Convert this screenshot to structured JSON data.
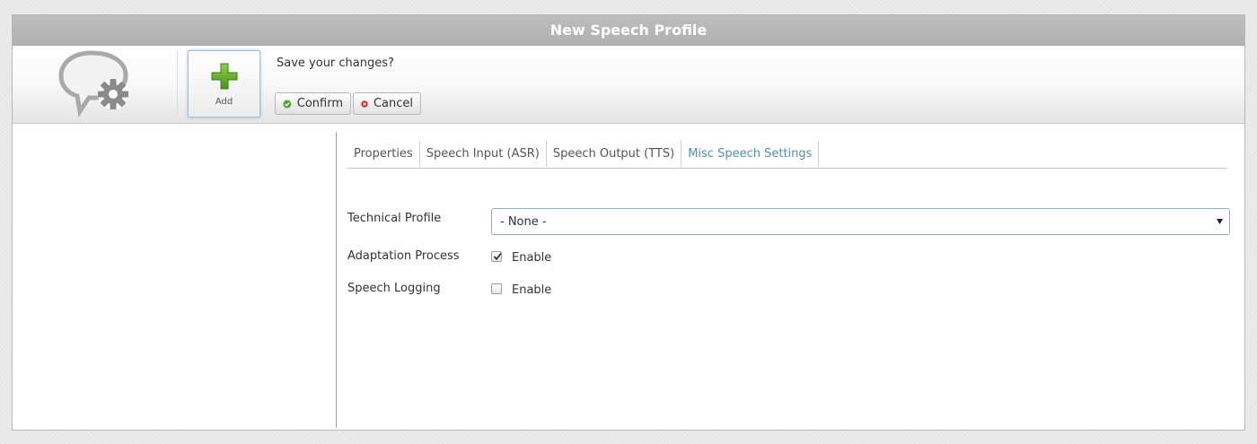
{
  "window": {
    "title": "New Speech Profile"
  },
  "toolbar": {
    "add_label": "Add",
    "prompt": "Save your changes?",
    "confirm_label": "Confirm",
    "cancel_label": "Cancel"
  },
  "tabs": [
    {
      "label": "Properties",
      "active": false
    },
    {
      "label": "Speech Input (ASR)",
      "active": false
    },
    {
      "label": "Speech Output (TTS)",
      "active": false
    },
    {
      "label": "Misc Speech Settings",
      "active": true
    }
  ],
  "form": {
    "technical_profile": {
      "label": "Technical Profile",
      "value": "- None -"
    },
    "adaptation_process": {
      "label": "Adaptation Process",
      "checked": true,
      "option_label": "Enable"
    },
    "speech_logging": {
      "label": "Speech Logging",
      "checked": false,
      "option_label": "Enable"
    }
  },
  "colors": {
    "accent": "#4d8fb3",
    "confirm_icon": "#5aa333",
    "cancel_icon": "#c0392b",
    "add_icon": "#6aaa2a"
  },
  "icons": {
    "logo": "speech-bubble-gear-icon",
    "add": "green-plus-icon",
    "confirm": "check-circle-icon",
    "cancel": "x-circle-icon",
    "dropdown": "triangle-down-icon",
    "checkmark": "checkmark-icon"
  }
}
